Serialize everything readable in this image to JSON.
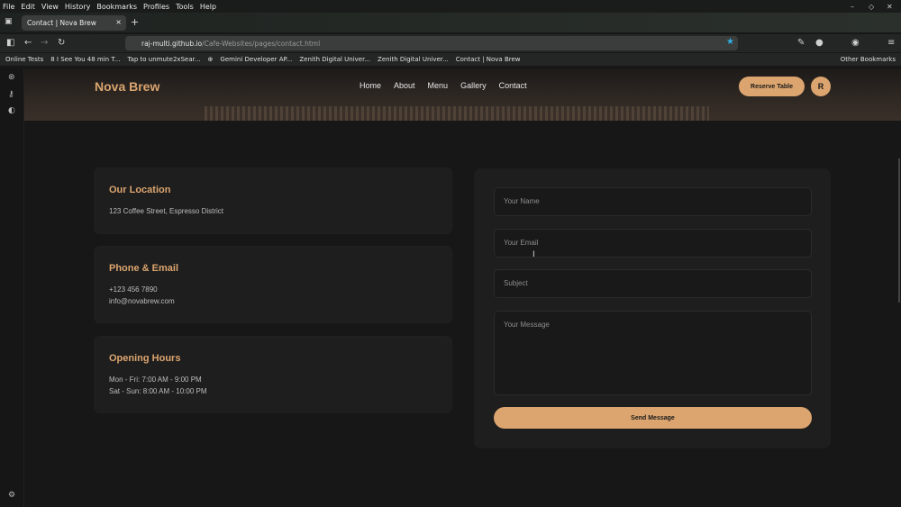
{
  "menubar": [
    "File",
    "Edit",
    "View",
    "History",
    "Bookmarks",
    "Profiles",
    "Tools",
    "Help"
  ],
  "tab": {
    "title": "Contact | Nova Brew",
    "close": "×",
    "new": "+"
  },
  "address": {
    "domain": "raj-multi.github.io",
    "path": "/Cafe-Websites/pages/contact.html"
  },
  "bookmarks": [
    "Online Tests",
    "8 I See You 48 min  T...",
    "Tap to unmute2xSear...",
    "",
    "Gemini Developer AP...",
    "Zenith Digital Univer...",
    "Zenith Digital Univer...",
    "Contact | Nova Brew"
  ],
  "other_bookmarks": "Other Bookmarks",
  "site": {
    "brand": "Nova Brew",
    "nav": [
      "Home",
      "About",
      "Menu",
      "Gallery",
      "Contact"
    ],
    "reserve": "Reserve Table",
    "avatar": "R"
  },
  "cards": [
    {
      "title": "Our Location",
      "lines": [
        "123 Coffee Street, Espresso District"
      ]
    },
    {
      "title": "Phone & Email",
      "lines": [
        "+123 456 7890",
        "info@novabrew.com"
      ]
    },
    {
      "title": "Opening Hours",
      "lines": [
        "Mon - Fri: 7:00 AM - 9:00 PM",
        "Sat - Sun: 8:00 AM - 10:00 PM"
      ]
    }
  ],
  "form": {
    "name_placeholder": "Your Name",
    "email_placeholder": "Your Email",
    "subject_placeholder": "Subject",
    "message_placeholder": "Your Message",
    "send": "Send Message"
  },
  "colors": {
    "accent": "#dca56f",
    "background": "#171717",
    "card": "#1e1e1e"
  }
}
